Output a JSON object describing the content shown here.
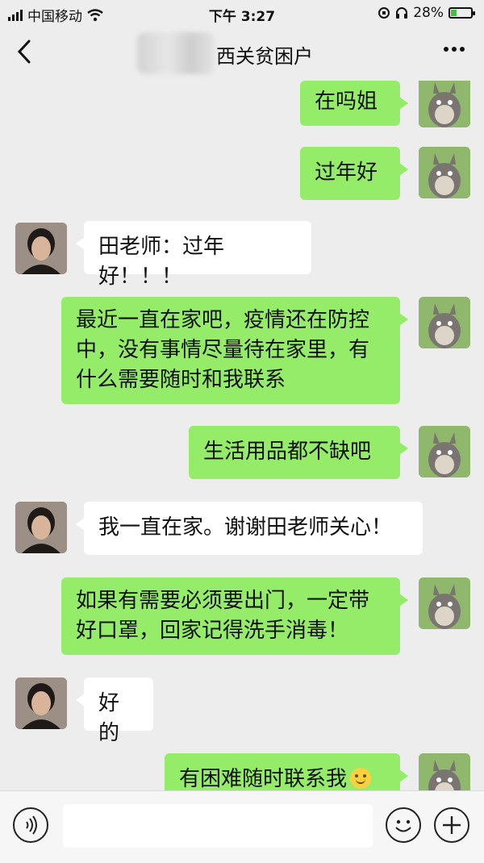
{
  "status_bar": {
    "carrier": "中国移动",
    "time": "下午 3:27",
    "battery_percent": "28%",
    "battery_level": 0.28,
    "battery_color": "#39c43b"
  },
  "header": {
    "title": "西关贫困户",
    "back_icon": "chevron-left-icon",
    "more_icon": "more-dots-icon"
  },
  "messages": [
    {
      "side": "me",
      "text": "在吗姐"
    },
    {
      "side": "me",
      "text": "过年好"
    },
    {
      "side": "them",
      "text": "田老师：过年好！！！"
    },
    {
      "side": "me",
      "text": "最近一直在家吧，疫情还在防控中，没有事情尽量待在家里，有什么需要随时和我联系"
    },
    {
      "side": "me",
      "text": "生活用品都不缺吧"
    },
    {
      "side": "them",
      "text": "我一直在家。谢谢田老师关心！"
    },
    {
      "side": "me",
      "text": "如果有需要必须要出门，一定带好口罩，回家记得洗手消毒！"
    },
    {
      "side": "them",
      "text": "好的"
    },
    {
      "side": "me",
      "text": "有困难随时联系我"
    }
  ],
  "colors": {
    "my_bubble": "#95ec69",
    "their_bubble": "#ffffff",
    "chat_background": "#ededed"
  },
  "input_bar": {
    "voice_icon": "voice-icon",
    "emoji_icon": "emoji-icon",
    "plus_icon": "plus-icon"
  }
}
